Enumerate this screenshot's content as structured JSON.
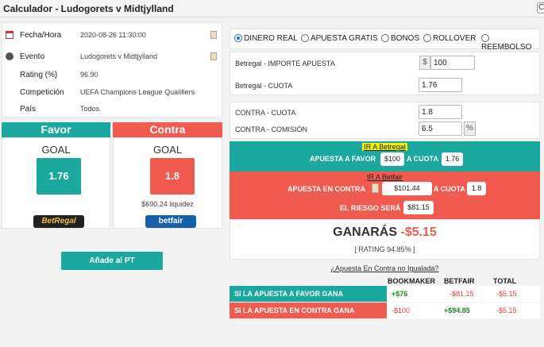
{
  "window": {
    "title": "Calculador - Ludogorets v Midtjylland",
    "corner_glyph": "C"
  },
  "info": {
    "rows": [
      {
        "label": "Fecha/Hora",
        "value": "2020-08-26 11:30:00",
        "icon": "calendar-icon"
      },
      {
        "label": "Evento",
        "value": "Ludogorets v Midtjylland",
        "icon": "football-icon"
      },
      {
        "label": "Rating (%)",
        "value": "96.90"
      },
      {
        "label": "Competición",
        "value": "UEFA Champions League Qualifiers"
      },
      {
        "label": "País",
        "value": "Todos"
      }
    ]
  },
  "favor": {
    "header": "Favor",
    "market": "GOAL",
    "odds": "1.76",
    "bookmaker": "BetRegal"
  },
  "contra": {
    "header": "Contra",
    "market": "GOAL",
    "odds": "1.8",
    "liquidity": "$690.24 liquidez",
    "exchange": "betfair"
  },
  "add_button": "Añade al PT",
  "mode_options": [
    {
      "label": "DINERO REAL",
      "selected": true
    },
    {
      "label": "APUESTA GRATIS",
      "selected": false
    },
    {
      "label": "BONOS",
      "selected": false
    },
    {
      "label": "ROLLOVER",
      "selected": false
    },
    {
      "label": "REEMBOLSO",
      "selected": false
    }
  ],
  "betregal": {
    "stake_label": "Betregal - IMPORTE APUESTA",
    "currency": "$",
    "stake_value": "100",
    "odds_label": "Betregal - CUOTA",
    "odds_value": "1.76"
  },
  "contra_inputs": {
    "odds_label": "CONTRA - CUOTA",
    "odds_value": "1.8",
    "commission_label": "CONTRA - COMISIÓN",
    "commission_value": "6.5",
    "percent": "%"
  },
  "favor_band": {
    "link": "IR A Betregal",
    "line_label": "APUESTA A FAVOR",
    "amount": "$100",
    "at_odds_label": "A CUOTA",
    "odds": "1.76"
  },
  "contra_band": {
    "link": "IR A Betfair",
    "line_label": "APUESTA EN CONTRA",
    "amount": "$101.44",
    "at_odds_label": "A CUOTA",
    "odds": "1.8",
    "risk_label": "EL RIESGO SERÁ",
    "risk": "$81.15"
  },
  "result": {
    "label": "GANARÁS",
    "value": "-$5.15",
    "rating": "[ RATING 94.85% ]"
  },
  "unmatched_link": "¿Apuesta En Contra no Igualada?",
  "table": {
    "headers": [
      "BOOKMAKER",
      "BETFAIR",
      "TOTAL"
    ],
    "rows": [
      {
        "label": "SI LA APUESTA A FAVOR GANA",
        "bookmaker": "+$76",
        "betfair": "-$81.15",
        "total": "-$5.15"
      },
      {
        "label": "SI LA APUESTA EN CONTRA GANA",
        "bookmaker": "-$100",
        "betfair": "+$94.85",
        "total": "-$5.15"
      }
    ]
  },
  "colors": {
    "favor": "#1aa89f",
    "contra": "#f05a4f",
    "highlight": "#f0f000"
  }
}
